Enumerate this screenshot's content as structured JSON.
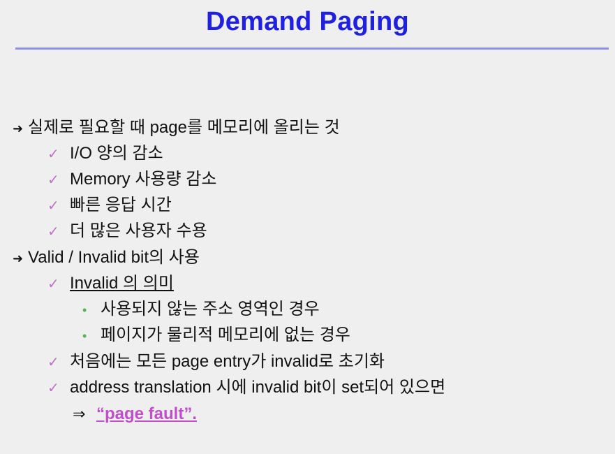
{
  "slide": {
    "title": "Demand Paging",
    "bullets": {
      "b1": {
        "marker": "➜",
        "text": "실제로 필요할 때 page를 메모리에 올리는 것",
        "sub": [
          {
            "marker": "✓",
            "text": "I/O 양의 감소"
          },
          {
            "marker": "✓",
            "text": "Memory 사용량 감소"
          },
          {
            "marker": "✓",
            "text": "빠른 응답 시간"
          },
          {
            "marker": "✓",
            "text": "더 많은 사용자 수용"
          }
        ]
      },
      "b2": {
        "marker": "➜",
        "text": "Valid / Invalid bit의 사용",
        "sub1": {
          "marker": "✓",
          "text": "Invalid 의 의미"
        },
        "sub1_items": [
          {
            "marker": "•",
            "text": "사용되지 않는 주소 영역인 경우"
          },
          {
            "marker": "•",
            "text": "페이지가 물리적 메모리에 없는 경우"
          }
        ],
        "sub2": {
          "marker": "✓",
          "text": "처음에는 모든 page entry가 invalid로 초기화"
        },
        "sub3": {
          "marker": "✓",
          "text": "address translation 시에 invalid bit이 set되어 있으면"
        },
        "result": {
          "marker": "⇒",
          "text": "“page fault”."
        }
      }
    }
  }
}
